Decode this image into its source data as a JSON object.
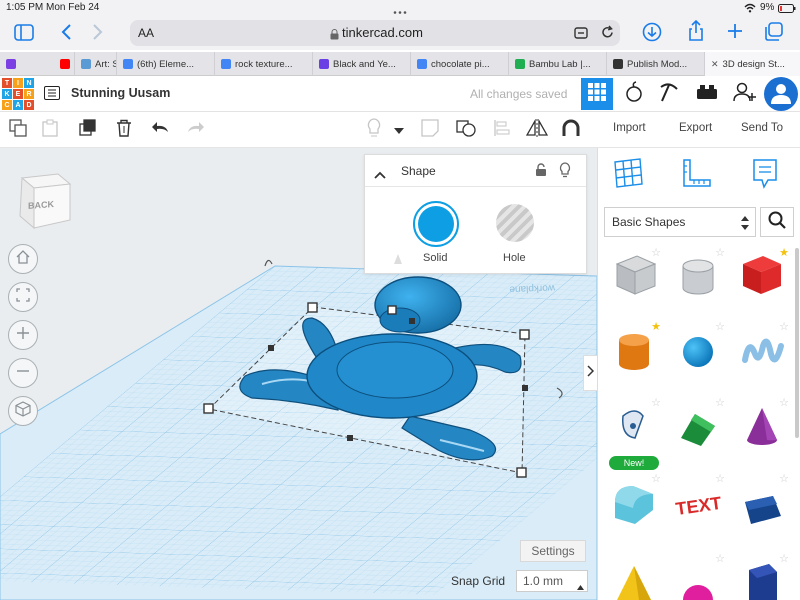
{
  "status_bar": {
    "time": "1:05 PM",
    "date": "Mon Feb 24",
    "battery": "9%"
  },
  "address_bar": {
    "text_size": "AA",
    "domain": "tinkercad.com"
  },
  "tabs": [
    {
      "label": "",
      "color": "#7b3fe4"
    },
    {
      "label": "",
      "color": "#ff0000"
    },
    {
      "label": "Art: S",
      "color": "#5b9bd5"
    },
    {
      "label": "(6th) Eleme...",
      "color": "#4285f4"
    },
    {
      "label": "rock texture...",
      "color": "#4285f4"
    },
    {
      "label": "Black and Ye...",
      "color": "#6a3fe4"
    },
    {
      "label": "chocolate pi...",
      "color": "#4285f4"
    },
    {
      "label": "Bambu Lab |...",
      "color": "#1fae52"
    },
    {
      "label": "Publish Mod...",
      "color": "#333333"
    },
    {
      "label": "3D design St...",
      "color": "#3fa9f5",
      "active": true
    }
  ],
  "app": {
    "logo_letters": [
      "TIN",
      "KER",
      "CAD"
    ],
    "project_name": "Stunning Uusam",
    "save_status": "All changes saved"
  },
  "toolbar": {
    "import": "Import",
    "export": "Export",
    "send_to": "Send To"
  },
  "viewcube": {
    "label": "BACK"
  },
  "shape_panel": {
    "title": "Shape",
    "solid_label": "Solid",
    "hole_label": "Hole",
    "solid_color": "#0d9ee3"
  },
  "workplane": {
    "watermark": "workplane"
  },
  "library": {
    "selected": "Basic Shapes",
    "new_badge": "New!"
  },
  "footer": {
    "settings": "Settings",
    "snap_grid_label": "Snap Grid",
    "snap_grid_value": "1.0 mm"
  },
  "colors": {
    "accent": "#1a8ee8",
    "shape": "#1e89c8",
    "selection": "#333333"
  }
}
